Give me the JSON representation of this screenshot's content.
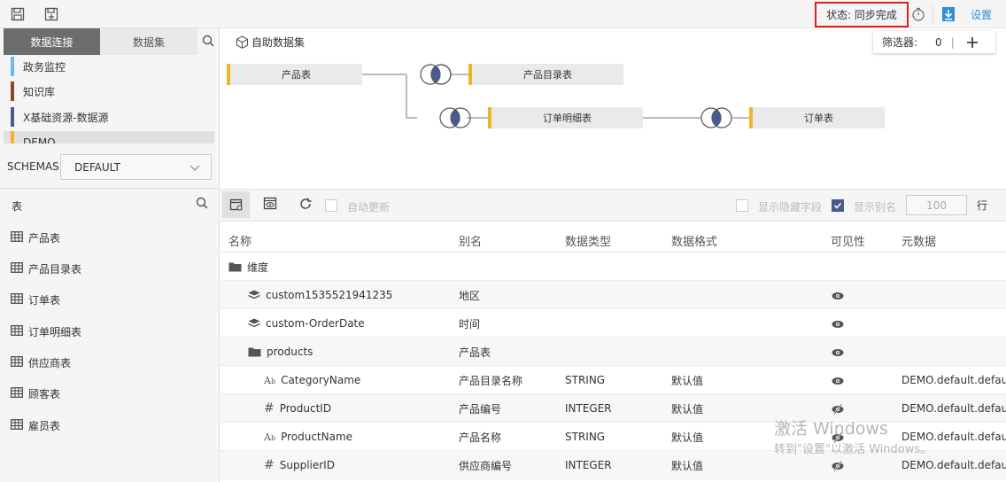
{
  "topbar": {
    "status_text": "状态: 同步完成",
    "settings_label": "设置"
  },
  "left": {
    "tabs": [
      {
        "label": "数据连接",
        "active": true
      },
      {
        "label": "数据集",
        "active": false
      }
    ],
    "connections": [
      {
        "label": "政务监控",
        "color": "#6fb8f5"
      },
      {
        "label": "知识库",
        "color": "#8b4a1d"
      },
      {
        "label": "X基础资源-数据源",
        "color": "#4a5a8c"
      },
      {
        "label": "DEMO",
        "color": "#f0b429"
      }
    ],
    "schemas_label": "SCHEMAS",
    "schemas_value": "DEFAULT",
    "tables_label": "表",
    "tables": [
      "产品表",
      "产品目录表",
      "订单表",
      "订单明细表",
      "供应商表",
      "顾客表",
      "雇员表"
    ]
  },
  "diagram": {
    "title": "自助数据集",
    "filter_label": "筛选器:",
    "filter_count": "0",
    "nodes": [
      {
        "label": "产品表"
      },
      {
        "label": "产品目录表"
      },
      {
        "label": "订单明细表"
      },
      {
        "label": "订单表"
      }
    ]
  },
  "toolbar": {
    "auto_update_label": "自动更新",
    "show_hidden_label": "显示隐藏字段",
    "show_alias_label": "显示别名",
    "rows_value": "100",
    "rows_unit": "行"
  },
  "table": {
    "headers": [
      "名称",
      "别名",
      "数据类型",
      "数据格式",
      "可见性",
      "元数据"
    ],
    "rows": [
      {
        "name": "维度",
        "alias": "",
        "type": "",
        "format": "",
        "meta": "",
        "icon": "folder-icon",
        "indent": 0,
        "eye": "none"
      },
      {
        "name": "custom1535521941235",
        "alias": "地区",
        "type": "",
        "format": "",
        "meta": "",
        "icon": "layers-icon",
        "indent": 1,
        "eye": "open"
      },
      {
        "name": "custom-OrderDate",
        "alias": "时间",
        "type": "",
        "format": "",
        "meta": "",
        "icon": "layers-icon",
        "indent": 1,
        "eye": "open"
      },
      {
        "name": "products",
        "alias": "产品表",
        "type": "",
        "format": "",
        "meta": "",
        "icon": "folder-icon",
        "indent": 1,
        "eye": "open"
      },
      {
        "name": "CategoryName",
        "alias": "产品目录名称",
        "type": "STRING",
        "format": "默认值",
        "meta": "DEMO.default.defau",
        "icon": "text-type-icon",
        "indent": 2,
        "eye": "open"
      },
      {
        "name": "ProductID",
        "alias": "产品编号",
        "type": "INTEGER",
        "format": "默认值",
        "meta": "DEMO.default.defau",
        "icon": "number-type-icon",
        "indent": 2,
        "eye": "hidden"
      },
      {
        "name": "ProductName",
        "alias": "产品名称",
        "type": "STRING",
        "format": "默认值",
        "meta": "DEMO.default.defau",
        "icon": "text-type-icon",
        "indent": 2,
        "eye": "hidden"
      },
      {
        "name": "SupplierID",
        "alias": "供应商编号",
        "type": "INTEGER",
        "format": "默认值",
        "meta": "DEMO.default.defau",
        "icon": "number-type-icon",
        "indent": 2,
        "eye": "hidden"
      }
    ]
  },
  "watermark": {
    "line1": "激活 Windows",
    "line2": "转到\"设置\"以激活 Windows。"
  },
  "colors": {
    "accent": "#2f8fd8",
    "node_marker": "#f0b429",
    "join_fill": "#4a5a8c",
    "status_border": "#e02020"
  }
}
